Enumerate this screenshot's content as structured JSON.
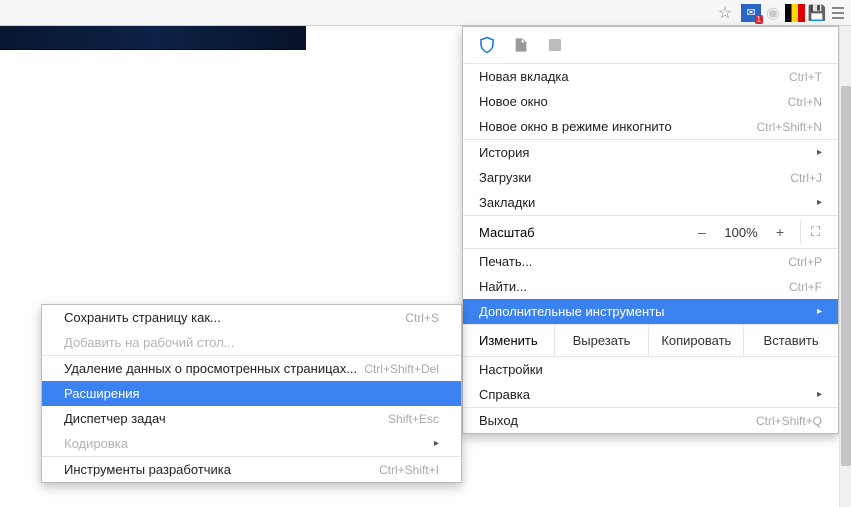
{
  "toolbar": {
    "mail_badge": "1"
  },
  "main_menu": {
    "new_tab": "Новая вкладка",
    "new_tab_sc": "Ctrl+T",
    "new_window": "Новое окно",
    "new_window_sc": "Ctrl+N",
    "incognito": "Новое окно в режиме инкогнито",
    "incognito_sc": "Ctrl+Shift+N",
    "history": "История",
    "downloads": "Загрузки",
    "downloads_sc": "Ctrl+J",
    "bookmarks": "Закладки",
    "zoom_label": "Масштаб",
    "zoom_minus": "–",
    "zoom_value": "100%",
    "zoom_plus": "+",
    "print": "Печать...",
    "print_sc": "Ctrl+P",
    "find": "Найти...",
    "find_sc": "Ctrl+F",
    "more_tools": "Дополнительные инструменты",
    "edit_label": "Изменить",
    "cut": "Вырезать",
    "copy": "Копировать",
    "paste": "Вставить",
    "settings": "Настройки",
    "help": "Справка",
    "exit": "Выход",
    "exit_sc": "Ctrl+Shift+Q"
  },
  "submenu": {
    "save_page": "Сохранить страницу как...",
    "save_page_sc": "Ctrl+S",
    "add_desktop": "Добавить на рабочий стол...",
    "clear_browsing": "Удаление данных о просмотренных страницах...",
    "clear_browsing_sc": "Ctrl+Shift+Del",
    "extensions": "Расширения",
    "task_manager": "Диспетчер задач",
    "task_manager_sc": "Shift+Esc",
    "encoding": "Кодировка",
    "devtools": "Инструменты разработчика",
    "devtools_sc": "Ctrl+Shift+I"
  }
}
